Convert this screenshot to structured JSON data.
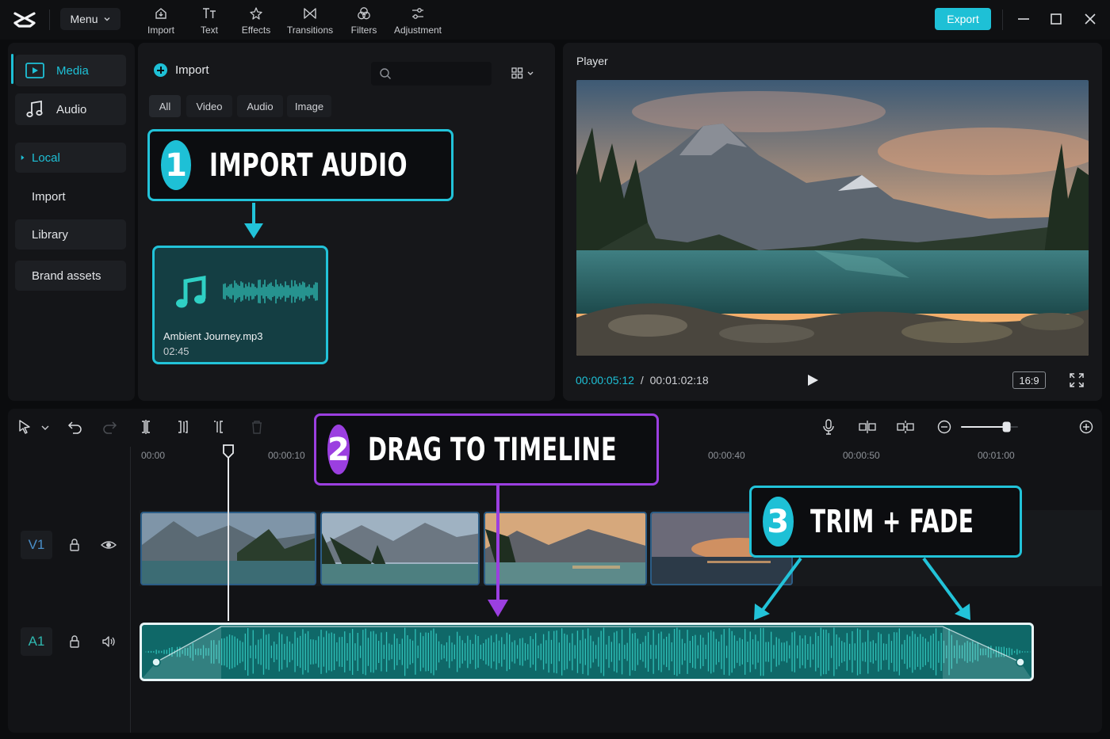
{
  "app": {
    "menu_label": "Menu",
    "export_label": "Export",
    "accent_color": "#1ec0d6",
    "highlight_purple": "#9b3fe0"
  },
  "toolbar": {
    "items": [
      {
        "label": "Import",
        "icon": "import-icon"
      },
      {
        "label": "Text",
        "icon": "text-icon"
      },
      {
        "label": "Effects",
        "icon": "effects-icon"
      },
      {
        "label": "Transitions",
        "icon": "transitions-icon"
      },
      {
        "label": "Filters",
        "icon": "filters-icon"
      },
      {
        "label": "Adjustment",
        "icon": "adjustment-icon"
      }
    ]
  },
  "sidebar": {
    "main": [
      {
        "label": "Media",
        "icon": "media-icon",
        "active": true
      },
      {
        "label": "Audio",
        "icon": "music-note-icon",
        "active": false
      }
    ],
    "sub": [
      {
        "label": "Local",
        "selected": true
      },
      {
        "label": "Import"
      },
      {
        "label": "Library"
      },
      {
        "label": "Brand assets"
      }
    ]
  },
  "media": {
    "import_label": "Import",
    "search_placeholder": "",
    "filters": [
      "All",
      "Video",
      "Audio",
      "Image"
    ],
    "active_filter": "All",
    "asset": {
      "name": "Ambient Journey.mp3",
      "duration": "02:45"
    }
  },
  "callouts": [
    {
      "number": "1",
      "text": "IMPORT AUDIO"
    },
    {
      "number": "2",
      "text": "DRAG TO TIMELINE"
    },
    {
      "number": "3",
      "text": "TRIM + FADE"
    }
  ],
  "player": {
    "title": "Player",
    "current_time": "00:00:05:12",
    "separator": "/",
    "total_time": "00:01:02:18",
    "aspect_ratio": "16:9"
  },
  "timeline": {
    "ruler": [
      "00:00",
      "00:00:10",
      "00:00:40",
      "00:00:50",
      "00:01:00"
    ],
    "tracks": [
      {
        "label": "V1",
        "icons": [
          "lock-icon",
          "eye-icon"
        ]
      },
      {
        "label": "A1",
        "icons": [
          "lock-icon",
          "speaker-icon"
        ]
      }
    ],
    "zoom_level": 0.8
  }
}
